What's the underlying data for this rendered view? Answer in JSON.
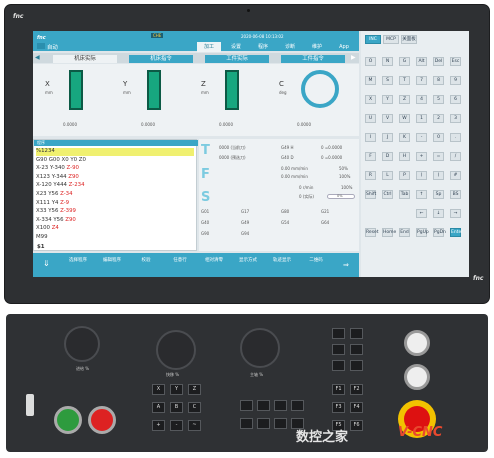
{
  "brand": {
    "logo": "fnc",
    "watermark_cn": "数控之家",
    "watermark_en": "V-CNC"
  },
  "header": {
    "mode": "自动",
    "status": "CHE",
    "datetime": "2020-06-08 10:13:02",
    "tabs": [
      "加工",
      "设置",
      "程序",
      "诊断",
      "维护",
      "App"
    ],
    "active_tab": 0
  },
  "coord_tabs": [
    "机床实际",
    "机床指令",
    "工件实际",
    "工件指令"
  ],
  "axes": [
    {
      "name": "X",
      "unit": "mm",
      "value": "0.0000"
    },
    {
      "name": "Y",
      "unit": "mm",
      "value": "0.0000"
    },
    {
      "name": "Z",
      "unit": "mm",
      "value": "0.0000"
    },
    {
      "name": "C",
      "unit": "deg",
      "value": "0.0000"
    }
  ],
  "program": {
    "title": "程序 ",
    "lines": [
      "%1234",
      "G90 G00 X0 Y0 Z0",
      "X-23 Y-340 Z-90",
      "X123 Y-344 Z90",
      "X-120 Y444 Z-234",
      "X23 Y56 Z-34",
      "X111 Y4 Z-9",
      "X33 Y56 Z-399",
      "X-334 Y56 Z90",
      "X100 Z4",
      "M99"
    ],
    "footer": "$1"
  },
  "status_panel": {
    "T": {
      "letter": "T",
      "rows": [
        "0000 (当前刀)",
        "0000 (预选刀)"
      ],
      "h": "G49  H",
      "h_val": "0 =0.0000",
      "d": "G40  D",
      "d_val": "0 =0.0000"
    },
    "F": {
      "letter": "F",
      "rows": [
        "0.00 mm/min",
        "0.00 mm/min"
      ],
      "pct1": "50%",
      "pct2": "100%"
    },
    "S": {
      "letter": "S",
      "rows": [
        "0 r/min",
        "0 (实际)"
      ],
      "pct1": "100%",
      "pct2": "0%"
    },
    "gcodes": [
      "G01",
      "G17",
      "G80",
      "G21",
      "G40",
      "G49",
      "G54",
      "G64",
      "G90",
      "G94"
    ]
  },
  "bottom_menu": [
    "选择程序",
    "编辑程序",
    "校验",
    "任意行",
    "相对清零",
    "显示方式",
    "轨迹显示",
    "二维码"
  ],
  "keypad": {
    "top": [
      "INC",
      "MCP",
      "关面板"
    ],
    "rows": [
      [
        "O",
        "N",
        "G",
        "Alt",
        "Del",
        "Esc"
      ],
      [
        "M",
        "S",
        "T",
        "7",
        "8",
        "9"
      ],
      [
        "X",
        "Y",
        "Z",
        "4",
        "5",
        "6"
      ],
      [
        "U",
        "V",
        "W",
        "1",
        "2",
        "3"
      ],
      [
        "I",
        "J",
        "K",
        "-",
        "0",
        "."
      ],
      [
        "F",
        "D",
        "H",
        "+",
        "=",
        "/"
      ],
      [
        "R",
        "L",
        "P",
        "(",
        ")",
        "#"
      ],
      [
        "Shift",
        "Ctrl",
        "Tab",
        "↑",
        "Sp",
        "BS"
      ],
      [
        "",
        "",
        "",
        "←",
        "↓",
        "→"
      ],
      [
        "Reset",
        "Home",
        "End",
        "PgUp",
        "PgDn",
        "Enter"
      ]
    ]
  },
  "operator": {
    "knob_labels": [
      "进给 %",
      "快移 %",
      "主轴 %"
    ],
    "axis_keys": [
      "X",
      "Y",
      "Z",
      "A",
      "B",
      "C",
      "+",
      "-",
      "~"
    ],
    "f_keys": [
      "F1",
      "F2",
      "F3",
      "F4",
      "F5",
      "F6"
    ]
  },
  "colors": {
    "accent": "#3aa6c6",
    "highlight": "#f0f070",
    "red": "#d22222"
  }
}
